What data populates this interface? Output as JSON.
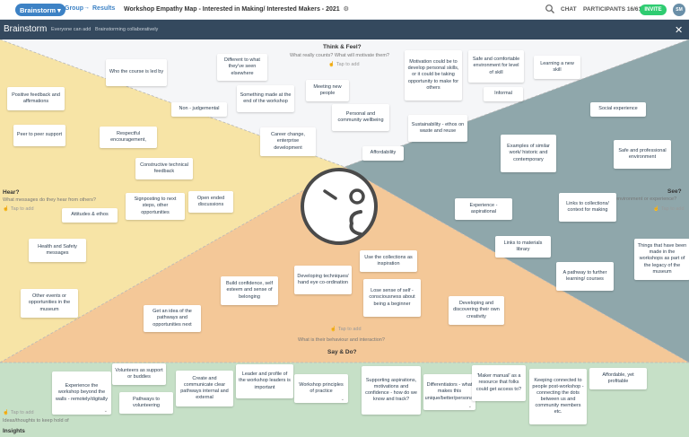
{
  "topbar": {
    "step_current": "Brainstorm",
    "step_next": "Group",
    "step_last": "Results",
    "arrow": "→",
    "board_title": "Workshop Empathy Map - Interested in Making/ Interested Makers - 2021",
    "chat_label": "CHAT",
    "participants_label": "PARTICIPANTS 16/61",
    "invite_label": "INVITE",
    "avatar_initials": "SM"
  },
  "subbar": {
    "title": "Brainstorm",
    "note1": "Everyone can add",
    "note2": "Brainstorming collaboratively"
  },
  "sections": {
    "think": {
      "title": "Think & Feel?",
      "question": "What really counts? What will motivate them?",
      "tap": "Tap to add"
    },
    "hear": {
      "title": "Hear?",
      "question": "What messages do they hear from others?",
      "tap": "Tap to add"
    },
    "see": {
      "title": "See?",
      "question": "environment or experience?",
      "tap": "Tap to add"
    },
    "say": {
      "title": "Say & Do?",
      "question": "What is their behaviour and interaction?",
      "tap": "Tap to add"
    },
    "insights": {
      "title": "Insights",
      "question": "Ideas/thoughts to keep hold of",
      "tap": "Tap to add"
    }
  },
  "notes": {
    "n1": "Who the course is led by",
    "n2": "Different to what they've seen elsewhere",
    "n3": "Motivation could be to develop personal skills, or it could be taking opportunity to make for others",
    "n4": "Safe and comfortable environment for level of skill",
    "n5": "Learning a new skill",
    "n6": "Positive feedback and affirmations",
    "n7": "Something made at the end of the workshop",
    "n8": "Meeting new people",
    "n9": "Non - judgemental",
    "n10": "Informal",
    "n11": "Peer to peer support",
    "n12": "Respectful encouragement,",
    "n13": "Personal and community wellbeing",
    "n14": "Sustainability - ethos on waste and reuse",
    "n15": "Social experience",
    "n16": "Career change, enterprise development",
    "n17": "Affordability",
    "n18": "Examples of similar work/ historic and contemporary",
    "n19": "Safe and professional environment",
    "n20": "Constructive technical feedback",
    "n21": "Signposting to next steps, other opportunities",
    "n22": "Open ended discussions",
    "n23": "Attitudes & ethos",
    "n24": "Experience - aspirational",
    "n25": "Links to collections/ context for making",
    "n26": "Health and Safety messages",
    "n27": "Links to materials library",
    "n28": "Things that have been made in the workshops as part of the legacy of the museum",
    "n29": "Use the collections as inspiration",
    "n30": "A pathway to further learning/ courses",
    "n31": "Developing techniques/ hand eye co-ordination",
    "n32": "Build confidence, self esteem and sense of belonging",
    "n33": "Lose sense of self - consciousness about being a beginner",
    "n34": "Other events or opportunities in the museum",
    "n35": "Developing and discovering their own creativity",
    "n36": "Get an idea of the pathways and opportunities next",
    "n37": "Experience the workshop beyond the walls - remotely/digitally",
    "n38": "Volunteers as support or buddies",
    "n39": "Create and communicate clear pathways internal and external",
    "n40": "Leader and profile of the workshop leaders is important",
    "n41": "Workshop principles of practice",
    "n42": "Supporting aspirations, motivations and confidence - how do we know and track?",
    "n43": "Differentiators - what makes this unique/better/personal",
    "n44": "'Maker manual' as a resource that folks could get access to?",
    "n45": "Keeping connected to people post-workshop - connecting the dots between us and community members etc.",
    "n46": "Affordable, yet profitable",
    "n47": "Pathways to volunteering"
  },
  "colors": {
    "think_bg": "#f5f6f8",
    "hear_bg": "#f7e4a6",
    "see_bg": "#8fa7ab",
    "say_bg": "#f4c898",
    "insights_bg": "#c6e0c7",
    "accent": "#3d82c5",
    "invite": "#2ecc71",
    "subbar": "#34495e"
  },
  "icons": [
    "search-icon",
    "settings-gear-icon",
    "close-icon",
    "tap-add-icon",
    "empathy-face-icon",
    "chevron-down-icon"
  ]
}
